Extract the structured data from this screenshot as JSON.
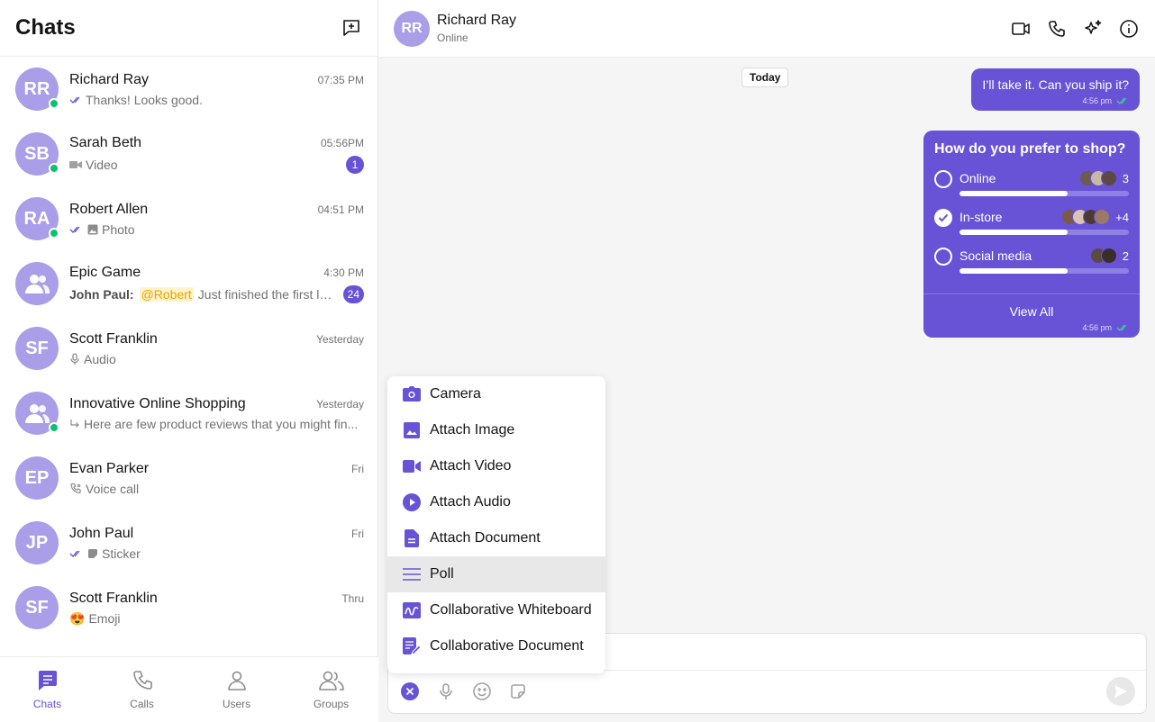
{
  "colors": {
    "accent": "#6852d6",
    "avatar_bg": "#aa9ee8",
    "online": "#09c26f",
    "mention": "#e6a500"
  },
  "sidebar": {
    "title": "Chats",
    "new_chat_icon": "new-chat-icon",
    "chats": [
      {
        "initials": "RR",
        "name": "Richard Ray",
        "time": "07:35 PM",
        "online": true,
        "icon": "read-ticks-icon",
        "text": "Thanks! Looks good.",
        "badge": ""
      },
      {
        "initials": "SB",
        "name": "Sarah Beth",
        "time": "05:56PM",
        "online": true,
        "icon": "video-icon",
        "text": "Video",
        "badge": "1"
      },
      {
        "initials": "RA",
        "name": "Robert Allen",
        "time": "04:51 PM",
        "online": true,
        "icon": "read-ticks-photo-icon",
        "text": "Photo",
        "badge": ""
      },
      {
        "initials": "",
        "name": "Epic Game",
        "time": "4:30 PM",
        "online": false,
        "group": true,
        "sender": "John Paul:",
        "mention": "@Robert",
        "text": "Just finished the first lev...",
        "badge": "24"
      },
      {
        "initials": "SF",
        "name": "Scott Franklin",
        "time": "Yesterday",
        "online": false,
        "icon": "mic-icon",
        "text": "Audio",
        "badge": ""
      },
      {
        "initials": "",
        "name": "Innovative Online Shopping",
        "time": "Yesterday",
        "online": true,
        "group": true,
        "icon": "reply-arrow-icon",
        "text": "Here are few product reviews that you might fin...",
        "badge": ""
      },
      {
        "initials": "EP",
        "name": "Evan Parker",
        "time": "Fri",
        "online": false,
        "icon": "phone-call-icon",
        "text": "Voice call",
        "badge": ""
      },
      {
        "initials": "JP",
        "name": "John Paul",
        "time": "Fri",
        "online": false,
        "icon": "read-ticks-sticker-icon",
        "text": "Sticker",
        "badge": ""
      },
      {
        "initials": "SF",
        "name": "Scott Franklin",
        "time": "Thru",
        "online": false,
        "icon": "emoji-icon",
        "text": "Emoji",
        "badge": ""
      }
    ]
  },
  "tabs": [
    {
      "label": "Chats",
      "icon": "chats-icon",
      "active": true
    },
    {
      "label": "Calls",
      "icon": "phone-icon",
      "active": false
    },
    {
      "label": "Users",
      "icon": "user-icon",
      "active": false
    },
    {
      "label": "Groups",
      "icon": "group-icon",
      "active": false
    }
  ],
  "header": {
    "initials": "RR",
    "name": "Richard Ray",
    "status": "Online"
  },
  "messages": {
    "date_chip": "Today",
    "msg1": {
      "text": "I’ll take it. Can you ship it?",
      "time": "4:56 pm"
    },
    "poll": {
      "question": "How do you prefer to shop?",
      "options": [
        {
          "label": "Online",
          "count": "3",
          "fraction": 0.64,
          "checked": false
        },
        {
          "label": "In-store",
          "count": "+4",
          "fraction": 0.64,
          "checked": true
        },
        {
          "label": "Social media",
          "count": "2",
          "fraction": 0.64,
          "checked": false
        }
      ],
      "view_all": "View All",
      "time": "4:56 pm"
    }
  },
  "attach_menu": [
    {
      "label": "Camera",
      "icon": "camera-icon"
    },
    {
      "label": "Attach Image",
      "icon": "image-icon"
    },
    {
      "label": "Attach Video",
      "icon": "video-icon"
    },
    {
      "label": "Attach Audio",
      "icon": "audio-play-icon"
    },
    {
      "label": "Attach Document",
      "icon": "document-icon"
    },
    {
      "label": "Poll",
      "icon": "poll-icon",
      "highlighted": true
    },
    {
      "label": "Collaborative Whiteboard",
      "icon": "whiteboard-icon"
    },
    {
      "label": "Collaborative Document",
      "icon": "collab-document-icon"
    }
  ]
}
